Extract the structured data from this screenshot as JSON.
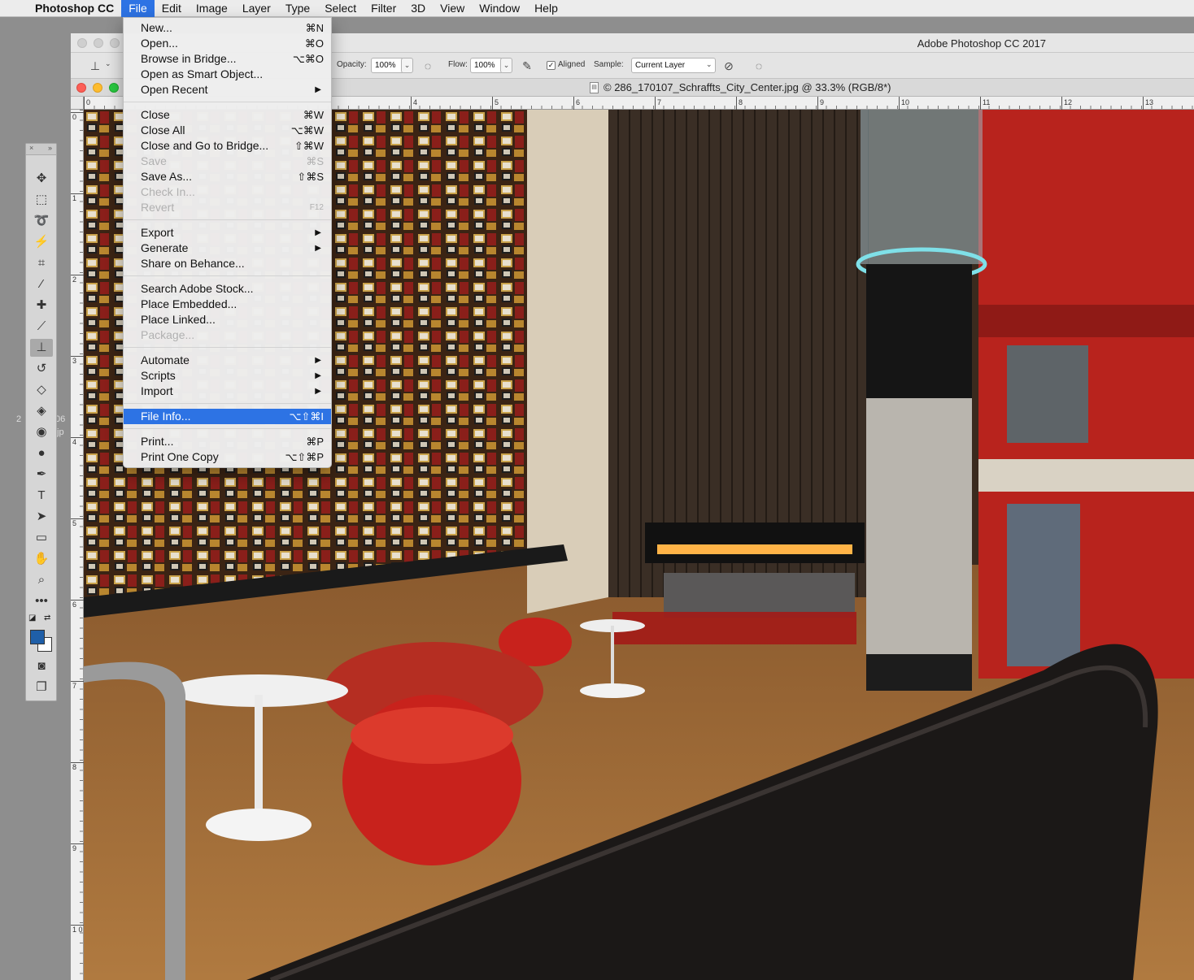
{
  "menubar": {
    "app_name": "Photoshop CC",
    "items": [
      "File",
      "Edit",
      "Image",
      "Layer",
      "Type",
      "Select",
      "Filter",
      "3D",
      "View",
      "Window",
      "Help"
    ]
  },
  "window": {
    "title": "Adobe Photoshop CC 2017"
  },
  "options_bar": {
    "opacity_label": "Opacity:",
    "opacity_value": "100%",
    "flow_label": "Flow:",
    "flow_value": "100%",
    "aligned_label": "Aligned",
    "aligned_checked": "✓",
    "sample_label": "Sample:",
    "sample_value": "Current Layer"
  },
  "document": {
    "tab_title": "© 286_170107_Schraffts_City_Center.jpg @ 33.3% (RGB/8*)",
    "background_fragment": "2",
    "background_fragment2": "06",
    "background_fragment3": "jp"
  },
  "ruler": {
    "top_labels": [
      "0",
      "4",
      "5",
      "6",
      "7",
      "8",
      "9",
      "10",
      "11",
      "12",
      "13"
    ],
    "left_labels": [
      "0",
      "1",
      "2",
      "3",
      "4",
      "5",
      "6",
      "7",
      "8",
      "9",
      "1 0"
    ]
  },
  "file_menu": {
    "groups": [
      [
        {
          "label": "New...",
          "shortcut": "⌘N"
        },
        {
          "label": "Open...",
          "shortcut": "⌘O"
        },
        {
          "label": "Browse in Bridge...",
          "shortcut": "⌥⌘O"
        },
        {
          "label": "Open as Smart Object...",
          "shortcut": ""
        },
        {
          "label": "Open Recent",
          "shortcut": "▶"
        }
      ],
      [
        {
          "label": "Close",
          "shortcut": "⌘W"
        },
        {
          "label": "Close All",
          "shortcut": "⌥⌘W"
        },
        {
          "label": "Close and Go to Bridge...",
          "shortcut": "⇧⌘W"
        },
        {
          "label": "Save",
          "shortcut": "⌘S"
        },
        {
          "label": "Save As...",
          "shortcut": "⇧⌘S"
        },
        {
          "label": "Check In...",
          "shortcut": ""
        },
        {
          "label": "Revert",
          "shortcut": "F12"
        }
      ],
      [
        {
          "label": "Export",
          "shortcut": "▶"
        },
        {
          "label": "Generate",
          "shortcut": "▶"
        },
        {
          "label": "Share on Behance...",
          "shortcut": ""
        }
      ],
      [
        {
          "label": "Search Adobe Stock...",
          "shortcut": ""
        },
        {
          "label": "Place Embedded...",
          "shortcut": ""
        },
        {
          "label": "Place Linked...",
          "shortcut": ""
        },
        {
          "label": "Package...",
          "shortcut": ""
        }
      ],
      [
        {
          "label": "Automate",
          "shortcut": "▶"
        },
        {
          "label": "Scripts",
          "shortcut": "▶"
        },
        {
          "label": "Import",
          "shortcut": "▶"
        }
      ],
      [
        {
          "label": "File Info...",
          "shortcut": "⌥⇧⌘I"
        }
      ],
      [
        {
          "label": "Print...",
          "shortcut": "⌘P"
        },
        {
          "label": "Print One Copy",
          "shortcut": "⌥⇧⌘P"
        }
      ]
    ]
  },
  "tools": {
    "header_close": "×",
    "header_expand": "»",
    "items": [
      "move-icon",
      "marquee-icon",
      "lasso-icon",
      "magic-wand-icon",
      "crop-icon",
      "eyedropper-icon",
      "healing-brush-icon",
      "brush-icon",
      "clone-stamp-icon",
      "history-brush-icon",
      "eraser-icon",
      "paint-bucket-icon",
      "blur-icon",
      "dodge-icon",
      "pen-icon",
      "type-icon",
      "path-selection-icon",
      "rectangle-icon",
      "hand-icon",
      "zoom-icon",
      "more-tools-icon"
    ],
    "foreground_color": "#1f5fa8",
    "background_color": "#ffffff"
  },
  "colors": {
    "menu_highlight": "#2d73e4",
    "accent_red": "#c8221c"
  }
}
